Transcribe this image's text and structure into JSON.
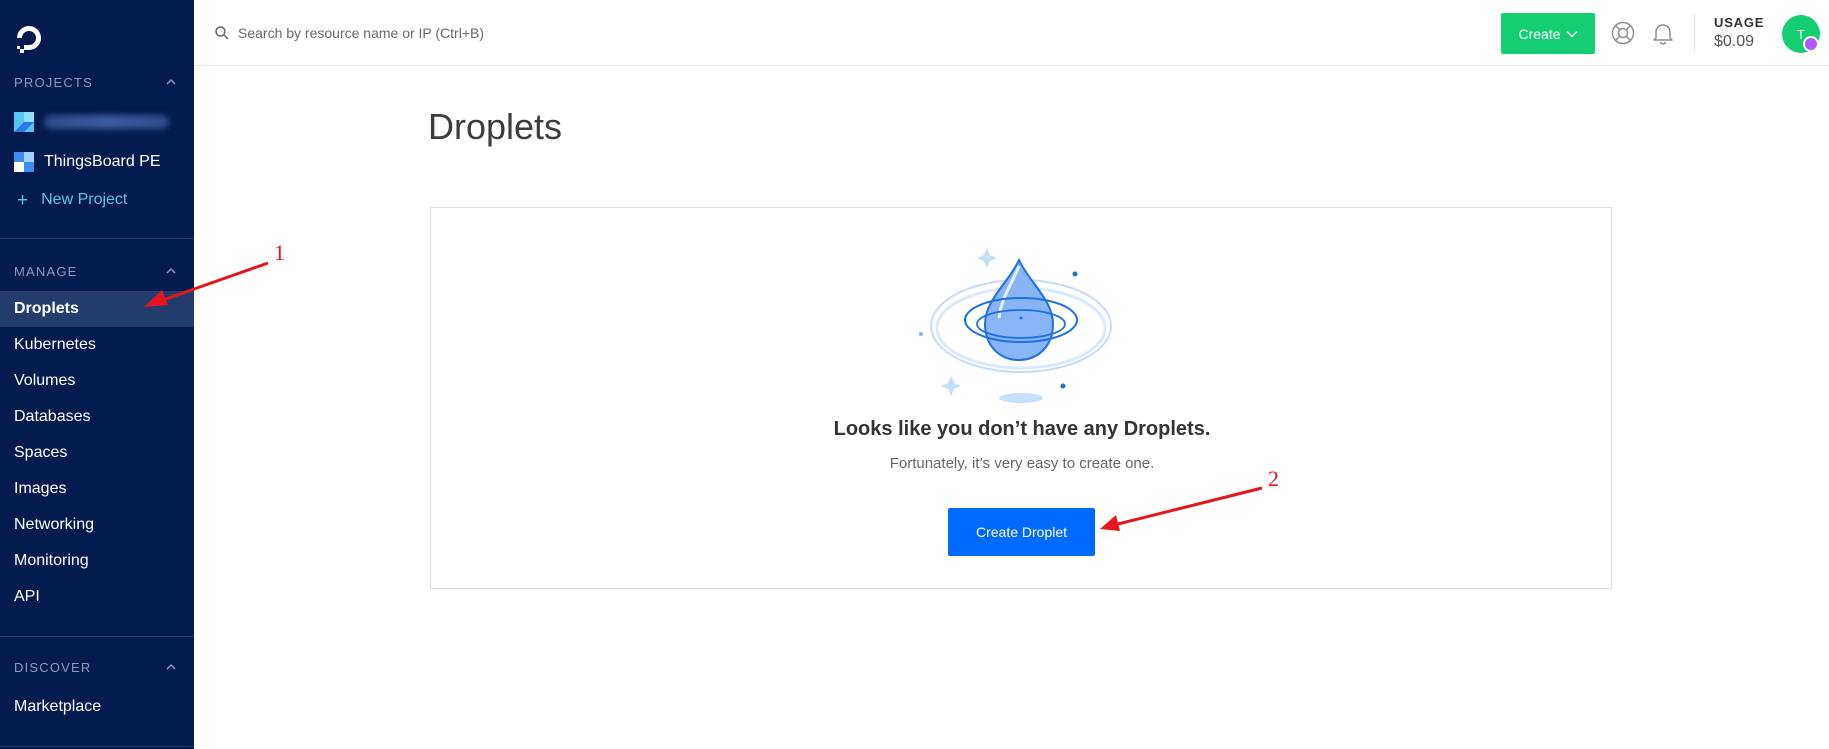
{
  "sidebar": {
    "sections": {
      "projects": "PROJECTS",
      "manage": "MANAGE",
      "discover": "DISCOVER"
    },
    "projects": [
      {
        "label": "ThingsBoard PE"
      }
    ],
    "new_project": "New Project",
    "plus_glyph": "+",
    "nav": [
      {
        "label": "Droplets",
        "active": true
      },
      {
        "label": "Kubernetes"
      },
      {
        "label": "Volumes"
      },
      {
        "label": "Databases"
      },
      {
        "label": "Spaces"
      },
      {
        "label": "Images"
      },
      {
        "label": "Networking"
      },
      {
        "label": "Monitoring"
      },
      {
        "label": "API"
      }
    ],
    "discover": [
      {
        "label": "Marketplace"
      }
    ]
  },
  "topbar": {
    "search_placeholder": "Search by resource name or IP (Ctrl+B)",
    "create_label": "Create",
    "usage_label": "USAGE",
    "usage_value": "$0.09",
    "avatar_initial": "T",
    "icons": [
      "search-icon",
      "help-icon",
      "bell-icon",
      "chevron-down-icon"
    ]
  },
  "main": {
    "title": "Droplets",
    "empty_title": "Looks like you don’t have any Droplets.",
    "empty_subtitle": "Fortunately, it’s very easy to create one.",
    "create_droplet_label": "Create Droplet"
  },
  "annotations": {
    "one": "1",
    "two": "2"
  },
  "colors": {
    "sidebar_bg": "#031b4e",
    "accent_green": "#15cd72",
    "accent_blue": "#0069ff",
    "annotation_red": "#e8141c"
  }
}
